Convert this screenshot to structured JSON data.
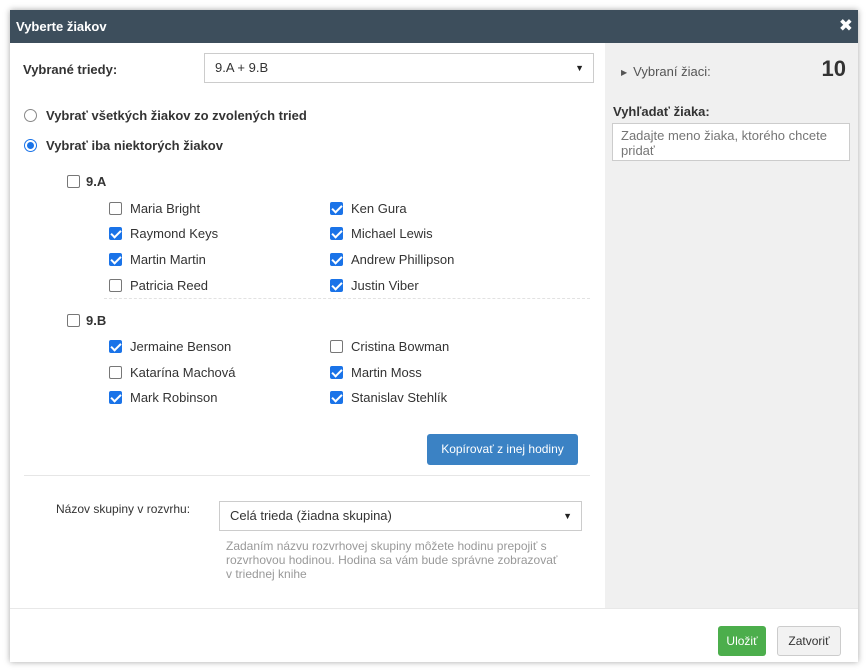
{
  "dialog": {
    "title": "Vyberte žiakov",
    "close_symbol": "✖"
  },
  "classes_field": {
    "label": "Vybrané triedy:",
    "value": "9.A + 9.B"
  },
  "options": {
    "all_label": "Vybrať všetkých žiakov zo zvolených tried",
    "some_label": "Vybrať iba niektorých žiakov",
    "selected": "some"
  },
  "classes": [
    {
      "name": "9.A",
      "checked": false,
      "students": [
        {
          "name": "Maria Bright",
          "checked": false
        },
        {
          "name": "Ken Gura",
          "checked": true
        },
        {
          "name": "Raymond Keys",
          "checked": true
        },
        {
          "name": "Michael Lewis",
          "checked": true
        },
        {
          "name": "Martin Martin",
          "checked": true
        },
        {
          "name": "Andrew Phillipson",
          "checked": true
        },
        {
          "name": "Patricia Reed",
          "checked": false
        },
        {
          "name": "Justin Viber",
          "checked": true
        }
      ]
    },
    {
      "name": "9.B",
      "checked": false,
      "students": [
        {
          "name": "Jermaine Benson",
          "checked": true
        },
        {
          "name": "Cristina Bowman",
          "checked": false
        },
        {
          "name": "Katarína Machová",
          "checked": false
        },
        {
          "name": "Martin Moss",
          "checked": true
        },
        {
          "name": "Mark Robinson",
          "checked": true
        },
        {
          "name": "Stanislav Stehlík",
          "checked": true
        }
      ]
    }
  ],
  "copy_button": "Kopírovať z inej hodiny",
  "group_field": {
    "label": "Názov skupiny v rozvrhu:",
    "value": "Celá trieda (žiadna skupina)",
    "help": "Zadaním názvu rozvrhovej skupiny môžete hodinu prepojiť s rozvrhovou hodinou. Hodina sa vám bude správne zobrazovať v triednej knihe"
  },
  "side_panel": {
    "selected_label": "Vybraní žiaci:",
    "selected_count": "10",
    "search_label": "Vyhľadať žiaka:",
    "search_placeholder": "Zadajte meno žiaka, ktorého chcete pridať"
  },
  "footer": {
    "save": "Uložiť",
    "close": "Zatvoriť"
  },
  "colors": {
    "titlebar": "#3d4e5c",
    "accent_blue": "#1a73e8",
    "button_blue": "#3b82c4",
    "button_green": "#4cae4c"
  }
}
